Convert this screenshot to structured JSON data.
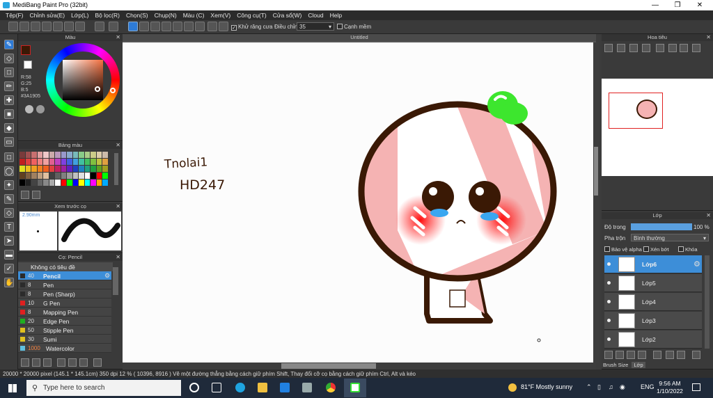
{
  "window": {
    "title": "MediBang Paint Pro (32bit)"
  },
  "menu": [
    "Tệp(F)",
    "Chỉnh sửa(E)",
    "Lớp(L)",
    "Bộ lọc(R)",
    "Chọn(S)",
    "Chụp(N)",
    "Màu (C)",
    "Xem(V)",
    "Công cụ(T)",
    "Cửa sổ(W)",
    "Cloud",
    "Help"
  ],
  "toolbar": {
    "antialias": "Khử răng cưa",
    "adjust_label": "Điều chỉnh",
    "adjust_value": "35",
    "soft_edge": "Cạnh mềm"
  },
  "color_panel": {
    "title": "Màu",
    "r": "R:58",
    "g": "G:25",
    "b": "B:5",
    "hex": "#3A1905"
  },
  "palette_panel": {
    "title": "Bảng màu"
  },
  "brush_preview": {
    "title": "Xem trước cọ",
    "size": "2.90mm"
  },
  "brush_panel": {
    "title": "Cọ: Pencil",
    "group": "Không có tiêu đề",
    "items": [
      {
        "size": "40",
        "name": "Pencil",
        "color": "#2b2b2b"
      },
      {
        "size": "8",
        "name": "Pen",
        "color": "#2b2b2b"
      },
      {
        "size": "8",
        "name": "Pen (Sharp)",
        "color": "#2b2b2b"
      },
      {
        "size": "10",
        "name": "G Pen",
        "color": "#e02020"
      },
      {
        "size": "8",
        "name": "Mapping Pen",
        "color": "#e02020"
      },
      {
        "size": "20",
        "name": "Edge Pen",
        "color": "#20b020"
      },
      {
        "size": "50",
        "name": "Stipple Pen",
        "color": "#e0c020"
      },
      {
        "size": "30",
        "name": "Sumi",
        "color": "#e0c020"
      },
      {
        "size": "1000",
        "name": "Watercolor",
        "color": "#60c0e0"
      }
    ]
  },
  "canvas": {
    "tab": "Untitled",
    "text_line1": "Tnolai1",
    "text_line2": "HD247"
  },
  "navigator": {
    "title": "Hoa tiêu"
  },
  "layers_panel": {
    "title": "Lớp",
    "opacity_label": "Độ trong",
    "opacity_value": "100 %",
    "blend_label": "Pha trộn",
    "blend_value": "Bình thường",
    "protect_alpha": "Bảo vệ alpha",
    "clipping": "Xén bớt",
    "lock": "Khóa",
    "layers": [
      "Lớp6",
      "Lớp5",
      "Lớp4",
      "Lớp3",
      "Lớp2"
    ],
    "bottom_tabs": [
      "Brush Size",
      "Lớp"
    ]
  },
  "status": {
    "text": "20000 * 20000 pixel   (145.1 * 145.1cm)   350 dpi   12 %   ( 10396, 8916 )   Vẽ một đường thẳng bằng cách giữ phím Shift, Thay đổi cỡ cọ bằng cách giữ phím Ctrl, Alt và kéo"
  },
  "taskbar": {
    "search_placeholder": "Type here to search",
    "weather": "81°F  Mostly sunny",
    "lang": "ENG",
    "time": "9:56 AM",
    "date": "1/10/2022"
  },
  "colors": {
    "accent": "#3d8ed8",
    "panel": "#3a3a3a",
    "pink": "#f5b3b3",
    "outline": "#3a1905",
    "leaf": "#3de62e"
  }
}
